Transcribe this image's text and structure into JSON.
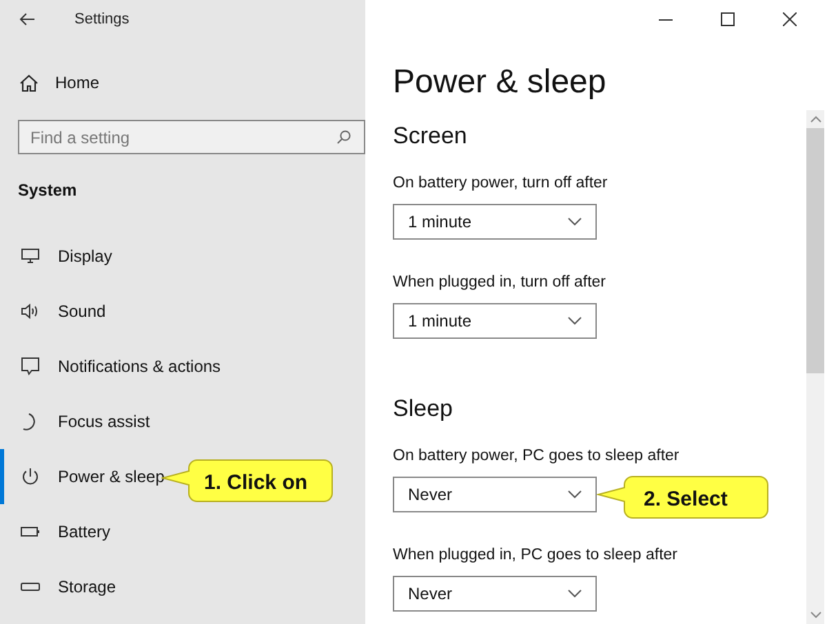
{
  "window": {
    "title": "Settings"
  },
  "sidebar": {
    "home": "Home",
    "search": {
      "placeholder": "Find a setting"
    },
    "section": "System",
    "items": [
      {
        "label": "Display",
        "selected": false
      },
      {
        "label": "Sound",
        "selected": false
      },
      {
        "label": "Notifications & actions",
        "selected": false
      },
      {
        "label": "Focus assist",
        "selected": false
      },
      {
        "label": "Power & sleep",
        "selected": true
      },
      {
        "label": "Battery",
        "selected": false
      },
      {
        "label": "Storage",
        "selected": false
      }
    ]
  },
  "page": {
    "title": "Power & sleep",
    "groups": [
      {
        "heading": "Screen",
        "settings": [
          {
            "label": "On battery power, turn off after",
            "value": "1 minute"
          },
          {
            "label": "When plugged in, turn off after",
            "value": "1 minute"
          }
        ]
      },
      {
        "heading": "Sleep",
        "settings": [
          {
            "label": "On battery power, PC goes to sleep after",
            "value": "Never"
          },
          {
            "label": "When plugged in, PC goes to sleep after",
            "value": "Never"
          }
        ]
      }
    ]
  },
  "callouts": [
    {
      "text": "1. Click on"
    },
    {
      "text": "2. Select"
    }
  ]
}
